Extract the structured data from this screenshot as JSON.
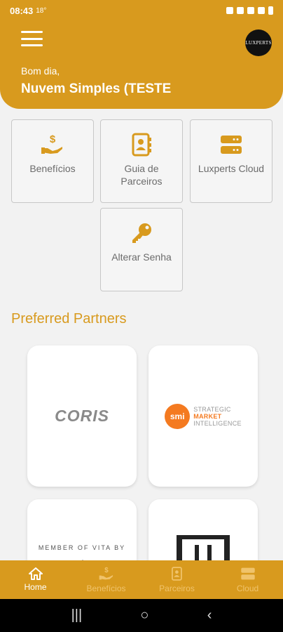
{
  "status_bar": {
    "time": "08:43",
    "temp": "18°"
  },
  "header": {
    "logo_text": "LUXPERTS",
    "greeting": "Bom dia,",
    "username": "Nuvem Simples (TESTE"
  },
  "tiles": [
    {
      "label": "Benefícios",
      "icon": "hand-dollar-icon"
    },
    {
      "label": "Guia de Parceiros",
      "icon": "address-book-icon"
    },
    {
      "label": "Luxperts Cloud",
      "icon": "server-icon"
    },
    {
      "label": "Alterar Senha",
      "icon": "key-icon"
    }
  ],
  "section_title": "Preferred Partners",
  "partners": [
    {
      "name": "CORIS"
    },
    {
      "badge": "smi",
      "line1": "STRATEGIC",
      "line2": "MARKET",
      "line3": "INTELLIGENCE"
    },
    {
      "text": "MEMBER OF VITA BY"
    },
    {
      "name": ""
    }
  ],
  "bottom_nav": [
    {
      "label": "Home",
      "icon": "home-icon",
      "active": true
    },
    {
      "label": "Benefícios",
      "icon": "hand-dollar-icon",
      "active": false
    },
    {
      "label": "Parceiros",
      "icon": "address-book-icon",
      "active": false
    },
    {
      "label": "Cloud",
      "icon": "server-icon",
      "active": false
    }
  ],
  "colors": {
    "accent": "#d89a1e",
    "smi_orange": "#f47a20"
  }
}
